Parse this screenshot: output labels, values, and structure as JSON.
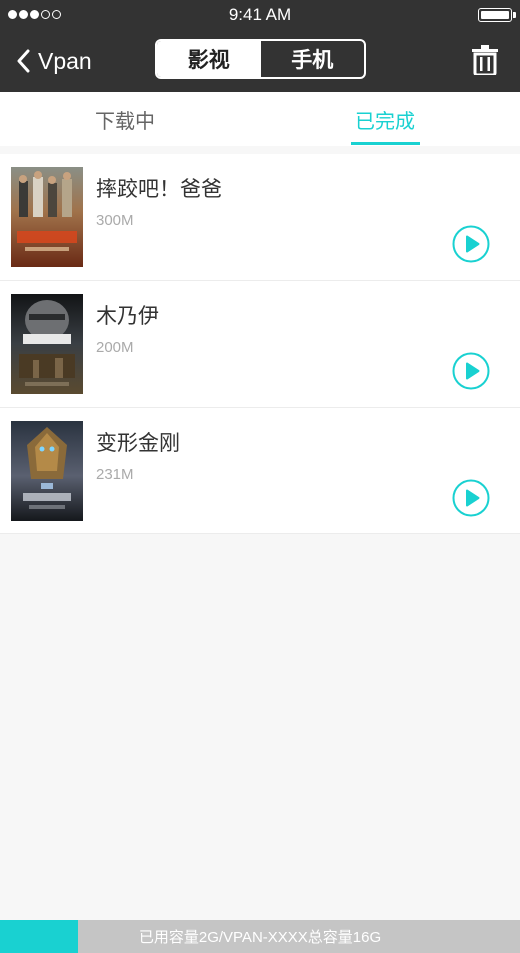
{
  "status_bar": {
    "time": "9:41 AM",
    "signal_filled": 3,
    "signal_total": 5
  },
  "nav": {
    "back_label": "Vpan",
    "segments": [
      "影视",
      "手机"
    ],
    "active_segment": "影视"
  },
  "tabs": {
    "downloading": "下载中",
    "completed": "已完成",
    "active": "已完成"
  },
  "items": [
    {
      "title": "摔跤吧！爸爸",
      "size": "300M"
    },
    {
      "title": "木乃伊",
      "size": "200M"
    },
    {
      "title": "变形金刚",
      "size": "231M"
    }
  ],
  "storage": {
    "text": "已用容量2G/VPAN-XXXX总容量16G",
    "used_fraction": 0.125
  },
  "colors": {
    "accent": "#19d1d1",
    "header_bg": "#333333"
  }
}
